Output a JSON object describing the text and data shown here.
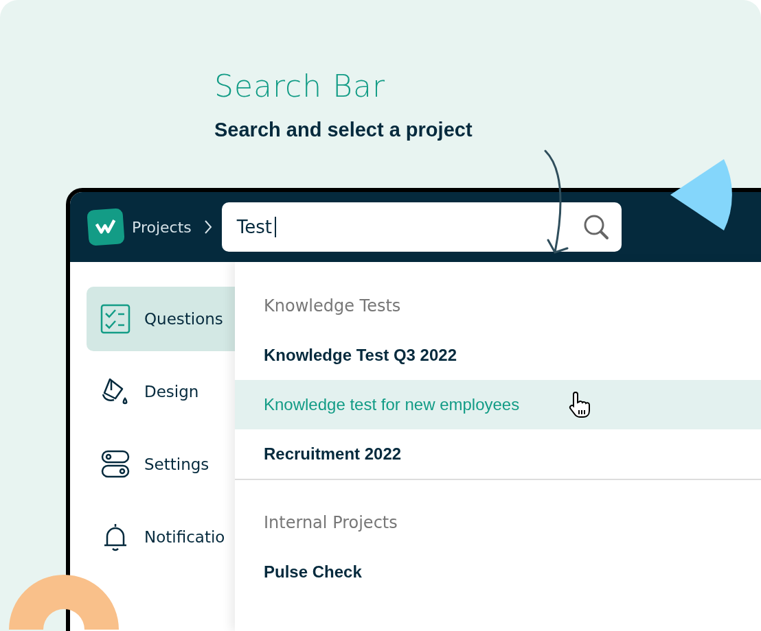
{
  "heading": "Search Bar",
  "subtitle": "Search and select a project",
  "window": {
    "breadcrumb": "Projects",
    "search": {
      "value": "Test"
    },
    "sidebar": {
      "items": [
        {
          "label": "Questions",
          "selected": true
        },
        {
          "label": "Design",
          "selected": false
        },
        {
          "label": "Settings",
          "selected": false
        },
        {
          "label": "Notificatio",
          "selected": false
        }
      ]
    },
    "dropdown": {
      "groups": [
        {
          "heading": "Knowledge Tests",
          "items": [
            {
              "label": "Knowledge Test Q3 2022",
              "selected": false
            },
            {
              "label": "Knowledge test for new employees",
              "selected": true
            },
            {
              "label": "Recruitment 2022",
              "selected": false
            }
          ]
        },
        {
          "heading": "Internal Projects",
          "items": [
            {
              "label": "Pulse Check",
              "selected": false
            }
          ]
        }
      ]
    }
  }
}
